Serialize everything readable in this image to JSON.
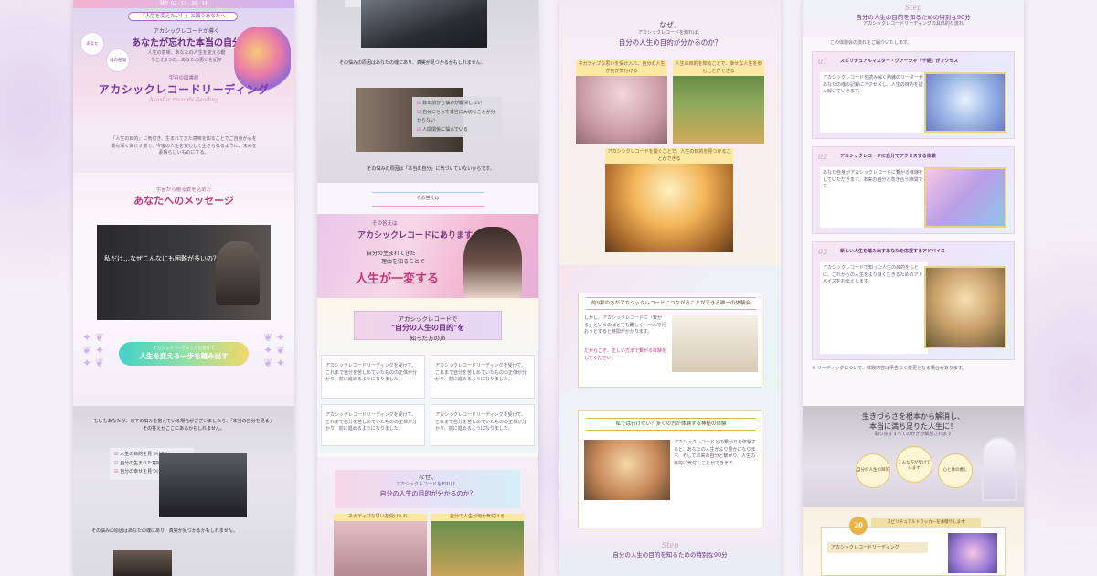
{
  "colors": {
    "accent_pink": "#c0397a",
    "accent_gold": "#b08a3a",
    "accent_teal": "#3cc8c0",
    "background": "#f4f0f7"
  },
  "col1": {
    "topbar_text": "残り 02 : 12 : 20 : 14",
    "hero_tag": "「人生を変えたい！」と願うあなたへ",
    "hero_line1": "アカシックレコードが導く",
    "hero_line2": "あなたが忘れた本当の自分",
    "hero_line3": "人生の意味、あなたの人生を変える鍵",
    "hero_line4": "今こそ9つの…あなたの思いを記す",
    "hero_badge1": "あなた",
    "hero_badge2": "魂の記憶",
    "hero_subtitle": "宇宙の図書館",
    "hero_title": "アカシックレコードリーディング",
    "hero_en": "Akashic records Reading",
    "hero_body": "「人生の目的」に気付き、生まれてきた意味を知ることでご自身が心を最も深く満たす道で、今後の人生を安心して生きられるように、未来を素晴らしいものにする。",
    "msg_small": "宇宙から贈る愛を込めた",
    "msg_title": "あなたへのメッセージ",
    "video_caption": "私だけ…なぜこんなにも困難が多いの？",
    "cta_small": "アカシックリーディングを受けて",
    "cta_label": "人生を変える一歩を踏み出す",
    "worry_intro": "もしもあなたが、以下の悩みを抱えている場合がございましたら、「本当の自分を見る」その答えがここにあるかもしれません。",
    "worries": [
      "人生の目的を見つけたい",
      "自分の生まれた意味を知りたい",
      "自分の幸せを見つけたい"
    ],
    "worry_footer": "その悩みの原因はあなたの魂にあり、真実が見つかるかもしれません。"
  },
  "col2": {
    "footer1": "その悩みの原因はあなたの魂にあり、真実が見つかるかもしれません。",
    "checklist": [
      "数年前から悩みが解決しない",
      "自分にとって本当に大切なことが分からない",
      "人間関係に悩んでいる"
    ],
    "footer2": "その悩みの原因は「本当の自分」に気づいていないからです。",
    "banner_small": "その答えは",
    "banner_title": "アカシックレコードにあります",
    "banner_q1": "自分の生まれてきた",
    "banner_q2": "理由を知ることで",
    "banner_main": "人生が一変する",
    "voice_title1": "アカシックレコードで",
    "voice_title2": "\"自分の人生の目的\"を",
    "voice_title3": "知った方の声",
    "voice_text": "アカシックレコードリーディングを受けて、これまで自分を苦しめていたものの正体が分かり、前に進めるようになりました。",
    "why_small": "なぜ、",
    "why_mid": "アカシックレコードを知れば、",
    "why_title": "自分の人生の目的が分かるのか？",
    "img_label1": "ネガティブな思いを受け入れ、",
    "img_label2": "自分の人生が何か気付ける"
  },
  "col3": {
    "why_small": "なぜ、",
    "why_mid": "アカシックレコードを知れば、",
    "why_title": "自分の人生の目的が分かるのか？",
    "card_label1": "ネガティブな思いを受け入れ、自分の人生が何か気付ける",
    "card_label2": "人生の目的を知ることで、幸せな人生を歩むことができる",
    "card_label3": "アカシックレコードを開くことで、人生の目的を見つけることができる",
    "section_title": "約9割の方がアカシックレコードにつながることができる唯一の体験会",
    "section_text": "しかし、アカシックレコードに「繋がる」というのはとても難しく、一人で行おうとすると時間がかかります。",
    "section_pink": "だからこそ、正しい方法で繋がる体験をしてください。",
    "feel_title": "私では行けない？多くの方が体験する神秘の体験",
    "feel_text": "アカシックレコードとの繋がりを体験すると、あなたの人生がより豊かになります。そして本来の自分と繋がり、人生の目的に気付くことができます。",
    "step_label": "Step",
    "step_title": "自分の人生の目的を知るための特別な90分"
  },
  "col4": {
    "step_label": "Step",
    "header_title": "自分の人生の目的を知るための特別な90分",
    "header_sub": "アカシックレコードリーディングの具体的な流れ",
    "intro": "この体験会の流れをご紹介いたします。",
    "steps": [
      {
        "num": "01",
        "title": "スピリチュアルマスター・グアーシャ「千姫」がアクセス",
        "body": "アカシックレコードを読み解く熟練のリーダーがあなたの魂の記録にアクセスし、人生の目的を読み解いていきます。"
      },
      {
        "num": "02",
        "title": "アカシックレコードに自分でアクセスする体験",
        "body": "あなた自身がアカシックレコードに繋がる体験をしていただきます。本来の自分と向き合う時間です。"
      },
      {
        "num": "03",
        "title": "新しい人生を踏み出すあなたを応援するアドバイス",
        "body": "アカシックレコードで知った人生の目的をもとに、これからの人生をより良く生きるためのアドバイスをお伝えします。"
      }
    ],
    "note": "※ リーディングについて、体験内容は予告なく変更となる場合があります。",
    "bottom_title1": "生きづらさを根本から解消し、",
    "bottom_title2": "本当に満ち足りた人生に！",
    "bottom_sub": "取り戻すすべてのかぎが解放されます",
    "circle1": "自分の人生の目的",
    "circle2": "こんな方が受けています",
    "circle3": "心と体の癒し",
    "bonus": "20",
    "bonus_label": "スピリチュアルトラッカーをお贈りします",
    "bottom_card": "アカシックレコードリーディング"
  }
}
